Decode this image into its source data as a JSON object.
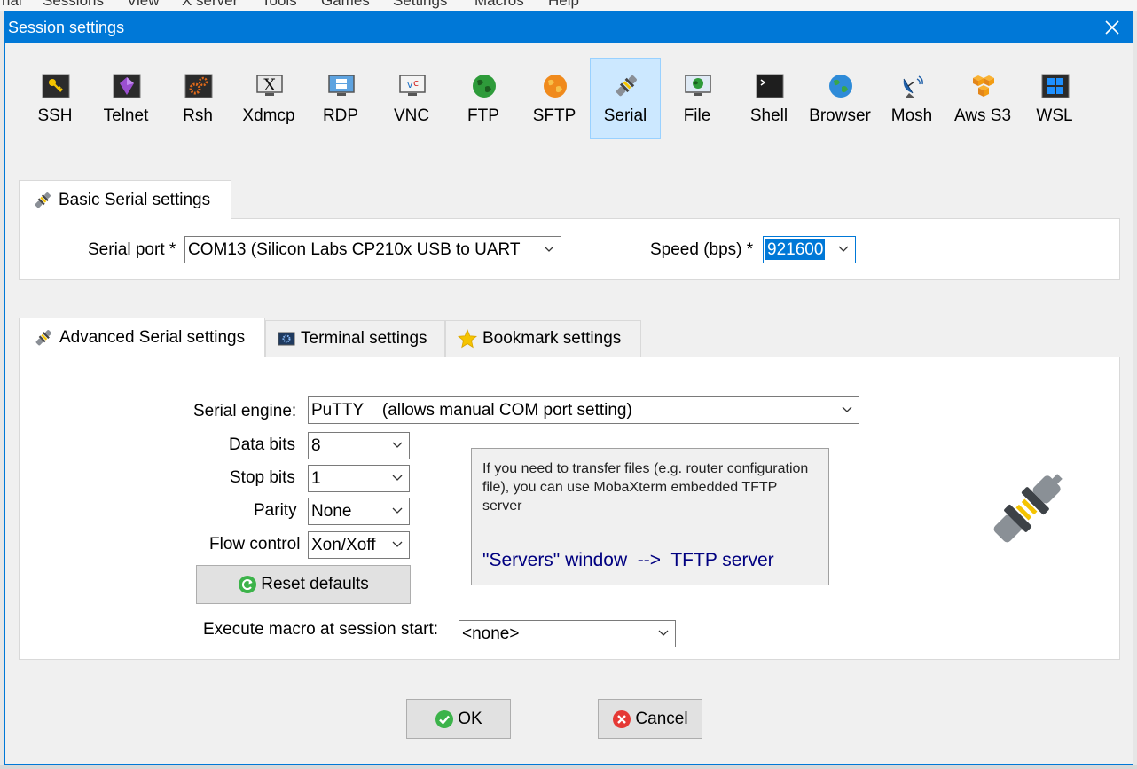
{
  "background_app": {
    "menu": [
      "rial",
      "Sessions",
      "View",
      "X server",
      "Tools",
      "Games",
      "Settings",
      "Macros",
      "Help"
    ]
  },
  "dialog": {
    "title": "Session settings",
    "close_icon": "close-icon"
  },
  "session_types": [
    {
      "label": "SSH",
      "icon": "key-icon",
      "selected": false
    },
    {
      "label": "Telnet",
      "icon": "purple-gem-icon",
      "selected": false
    },
    {
      "label": "Rsh",
      "icon": "gears-icon",
      "selected": false
    },
    {
      "label": "Xdmcp",
      "icon": "x-monitor-icon",
      "selected": false
    },
    {
      "label": "RDP",
      "icon": "windows-monitor-icon",
      "selected": false
    },
    {
      "label": "VNC",
      "icon": "vnc-monitor-icon",
      "selected": false
    },
    {
      "label": "FTP",
      "icon": "green-globe-icon",
      "selected": false
    },
    {
      "label": "SFTP",
      "icon": "orange-globe-icon",
      "selected": false
    },
    {
      "label": "Serial",
      "icon": "serial-plug-icon",
      "selected": true
    },
    {
      "label": "File",
      "icon": "file-monitor-icon",
      "selected": false
    },
    {
      "label": "Shell",
      "icon": "terminal-icon",
      "selected": false
    },
    {
      "label": "Browser",
      "icon": "blue-globe-icon",
      "selected": false
    },
    {
      "label": "Mosh",
      "icon": "satellite-dish-icon",
      "selected": false
    },
    {
      "label": "Aws S3",
      "icon": "aws-cubes-icon",
      "selected": false
    },
    {
      "label": "WSL",
      "icon": "windows-logo-icon",
      "selected": false
    }
  ],
  "basic": {
    "tab_label": "Basic Serial settings",
    "serial_port_label": "Serial port *",
    "serial_port_value": "COM13  (Silicon Labs CP210x USB to UART",
    "speed_label": "Speed (bps) *",
    "speed_value": "921600"
  },
  "advanced_tabs": [
    {
      "label": "Advanced Serial settings",
      "icon": "serial-plug-icon",
      "active": true
    },
    {
      "label": "Terminal settings",
      "icon": "terminal-gear-icon",
      "active": false
    },
    {
      "label": "Bookmark settings",
      "icon": "star-icon",
      "active": false
    }
  ],
  "advanced": {
    "engine_label": "Serial engine:",
    "engine_value": "PuTTY    (allows manual COM port setting)",
    "data_bits_label": "Data bits",
    "data_bits_value": "8",
    "stop_bits_label": "Stop bits",
    "stop_bits_value": "1",
    "parity_label": "Parity",
    "parity_value": "None",
    "flow_label": "Flow control",
    "flow_value": "Xon/Xoff",
    "reset_label": "Reset defaults",
    "macro_label": "Execute macro at session start:",
    "macro_value": "<none>",
    "info_text": "If you need to transfer files (e.g. router configuration file), you can use MobaXterm embedded TFTP server",
    "info_link": "\"Servers\" window  -->  TFTP server"
  },
  "footer": {
    "ok_label": "OK",
    "cancel_label": "Cancel"
  },
  "colors": {
    "titlebar": "#0078d7",
    "selected_tile": "#cce8ff",
    "info_link": "#000080"
  }
}
